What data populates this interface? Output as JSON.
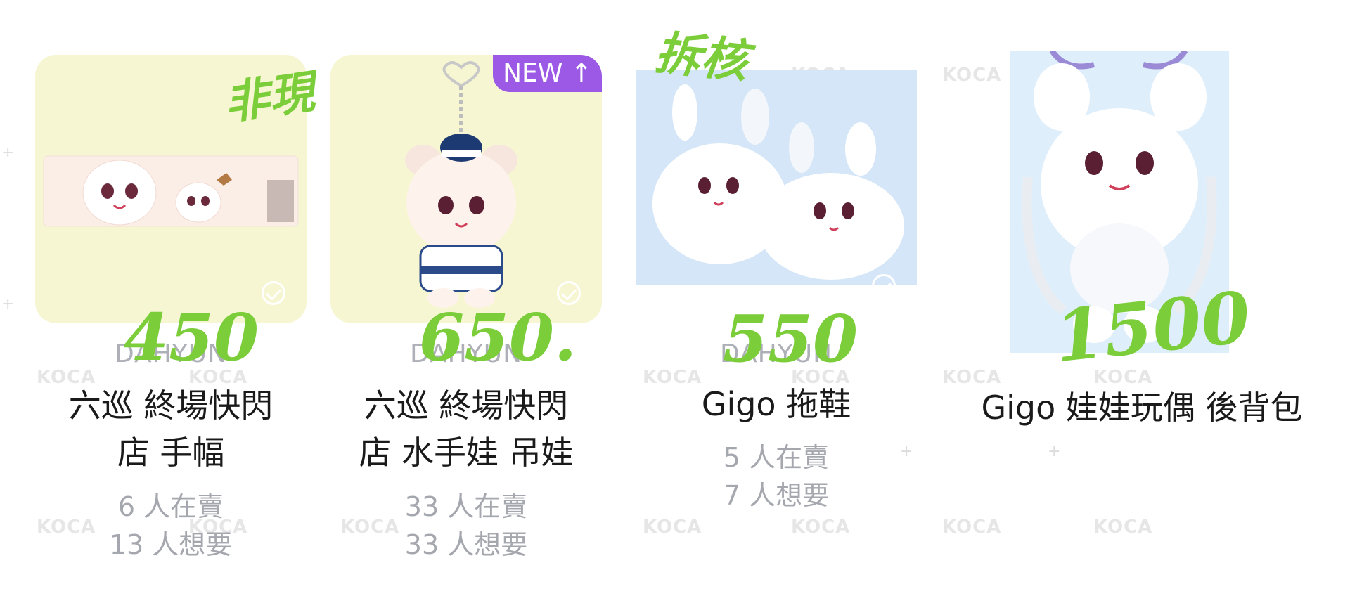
{
  "watermark": "KOCA",
  "products": [
    {
      "artist": "DAHYUN",
      "title_line1": "六巡 終場快閃",
      "title_line2": "店 手幅",
      "sellers": "6 人在賣",
      "wanters": "13 人想要",
      "price_note": "450",
      "tag_note": "非現"
    },
    {
      "badge": "NEW ↑",
      "artist": "DAHYUN",
      "title_line1": "六巡 終場快閃",
      "title_line2": "店 水手娃 吊娃",
      "sellers": "33 人在賣",
      "wanters": "33 人想要",
      "price_note": "650."
    },
    {
      "artist": "DAHYUN",
      "title_line1": "Gigo 拖鞋",
      "sellers": "5 人在賣",
      "wanters": "7 人想要",
      "price_note": "550",
      "tag_note": "拆核"
    },
    {
      "title_line1": "Gigo 娃娃玩偶 後背包",
      "price_note": "1500"
    }
  ],
  "colors": {
    "accent_new": "#9b59e6",
    "handwriting": "#7ccd3a",
    "thumb_yellow": "#f7f6d2"
  }
}
